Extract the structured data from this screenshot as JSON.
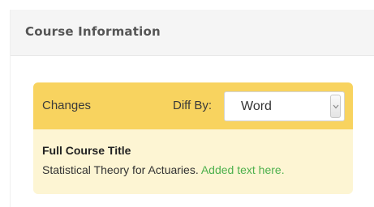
{
  "panel": {
    "title": "Course Information"
  },
  "changes": {
    "label": "Changes",
    "diff_by_label": "Diff By:",
    "diff_select": {
      "selected": "Word"
    }
  },
  "field": {
    "label": "Full Course Title",
    "original_text": "Statistical Theory for Actuaries.",
    "added_text": "Added text here."
  },
  "colors": {
    "header_bar": "#f8d35f",
    "content_bg": "#fdf5d3",
    "added_text": "#4cb04c"
  }
}
